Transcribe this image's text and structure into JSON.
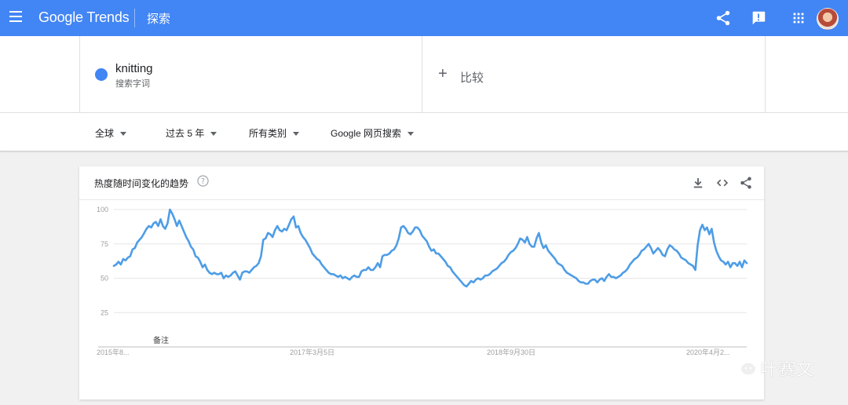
{
  "app": {
    "logo_text": "Google Trends",
    "page_heading": "探索"
  },
  "header_icons": [
    "share-icon",
    "feedback-icon",
    "apps-icon",
    "avatar"
  ],
  "search_terms": [
    {
      "name": "knitting",
      "type_label": "搜索字词",
      "color": "#4285f4"
    }
  ],
  "compare": {
    "label": "比较"
  },
  "filters": {
    "region": "全球",
    "time_range": "过去 5 年",
    "category": "所有类别",
    "search_type": "Google 网页搜索"
  },
  "chart_card": {
    "title": "热度随时间变化的趋势",
    "note_label": "备注",
    "actions": [
      "download-icon",
      "embed-icon",
      "share-icon"
    ]
  },
  "chart_data": {
    "type": "line",
    "title": "热度随时间变化的趋势",
    "xlabel": "",
    "ylabel": "",
    "ylim": [
      0,
      100
    ],
    "yticks": [
      25,
      50,
      75,
      100
    ],
    "xtick_labels": [
      "2015年8...",
      "2017年3月5日",
      "2018年9月30日",
      "2020年4月2..."
    ],
    "grid": true,
    "legend": "none",
    "line_color": "#4e9de6",
    "series": [
      {
        "name": "knitting",
        "values": [
          59,
          60,
          62,
          60,
          64,
          63,
          65,
          66,
          71,
          72,
          76,
          78,
          80,
          83,
          86,
          88,
          87,
          90,
          91,
          88,
          93,
          88,
          86,
          90,
          100,
          97,
          93,
          88,
          92,
          88,
          84,
          80,
          77,
          73,
          71,
          66,
          65,
          62,
          58,
          60,
          56,
          54,
          53,
          54,
          53,
          53,
          54,
          50,
          52,
          51,
          52,
          54,
          55,
          52,
          49,
          54,
          55,
          55,
          54,
          56,
          58,
          59,
          61,
          66,
          78,
          79,
          83,
          82,
          80,
          85,
          88,
          85,
          84,
          86,
          85,
          89,
          93,
          95,
          87,
          88,
          83,
          80,
          78,
          75,
          72,
          68,
          66,
          64,
          63,
          60,
          58,
          56,
          54,
          53,
          53,
          52,
          51,
          52,
          50,
          51,
          50,
          49,
          51,
          52,
          51,
          51,
          55,
          56,
          56,
          58,
          56,
          56,
          58,
          61,
          58,
          66,
          67,
          67,
          68,
          70,
          71,
          74,
          79,
          87,
          88,
          86,
          83,
          82,
          84,
          87,
          87,
          85,
          81,
          79,
          77,
          73,
          70,
          71,
          68,
          68,
          66,
          64,
          62,
          59,
          58,
          55,
          53,
          51,
          49,
          47,
          45,
          44,
          46,
          48,
          47,
          49,
          50,
          49,
          50,
          52,
          52,
          53,
          55,
          56,
          57,
          59,
          61,
          62,
          64,
          67,
          69,
          70,
          72,
          75,
          79,
          78,
          76,
          80,
          75,
          73,
          73,
          79,
          83,
          76,
          72,
          74,
          70,
          68,
          66,
          64,
          61,
          60,
          59,
          56,
          54,
          53,
          52,
          51,
          50,
          48,
          47,
          47,
          46,
          46,
          48,
          49,
          49,
          47,
          49,
          50,
          48,
          51,
          53,
          51,
          51,
          50,
          51,
          52,
          54,
          55,
          57,
          60,
          62,
          64,
          65,
          67,
          70,
          71,
          73,
          75,
          72,
          68,
          70,
          72,
          70,
          67,
          66,
          71,
          74,
          73,
          71,
          70,
          68,
          65,
          64,
          63,
          61,
          60,
          59,
          56,
          74,
          85,
          89,
          85,
          87,
          82,
          86,
          76,
          70,
          66,
          63,
          62,
          60,
          62,
          58,
          61,
          61,
          59,
          62,
          58,
          63,
          61
        ]
      }
    ]
  }
}
